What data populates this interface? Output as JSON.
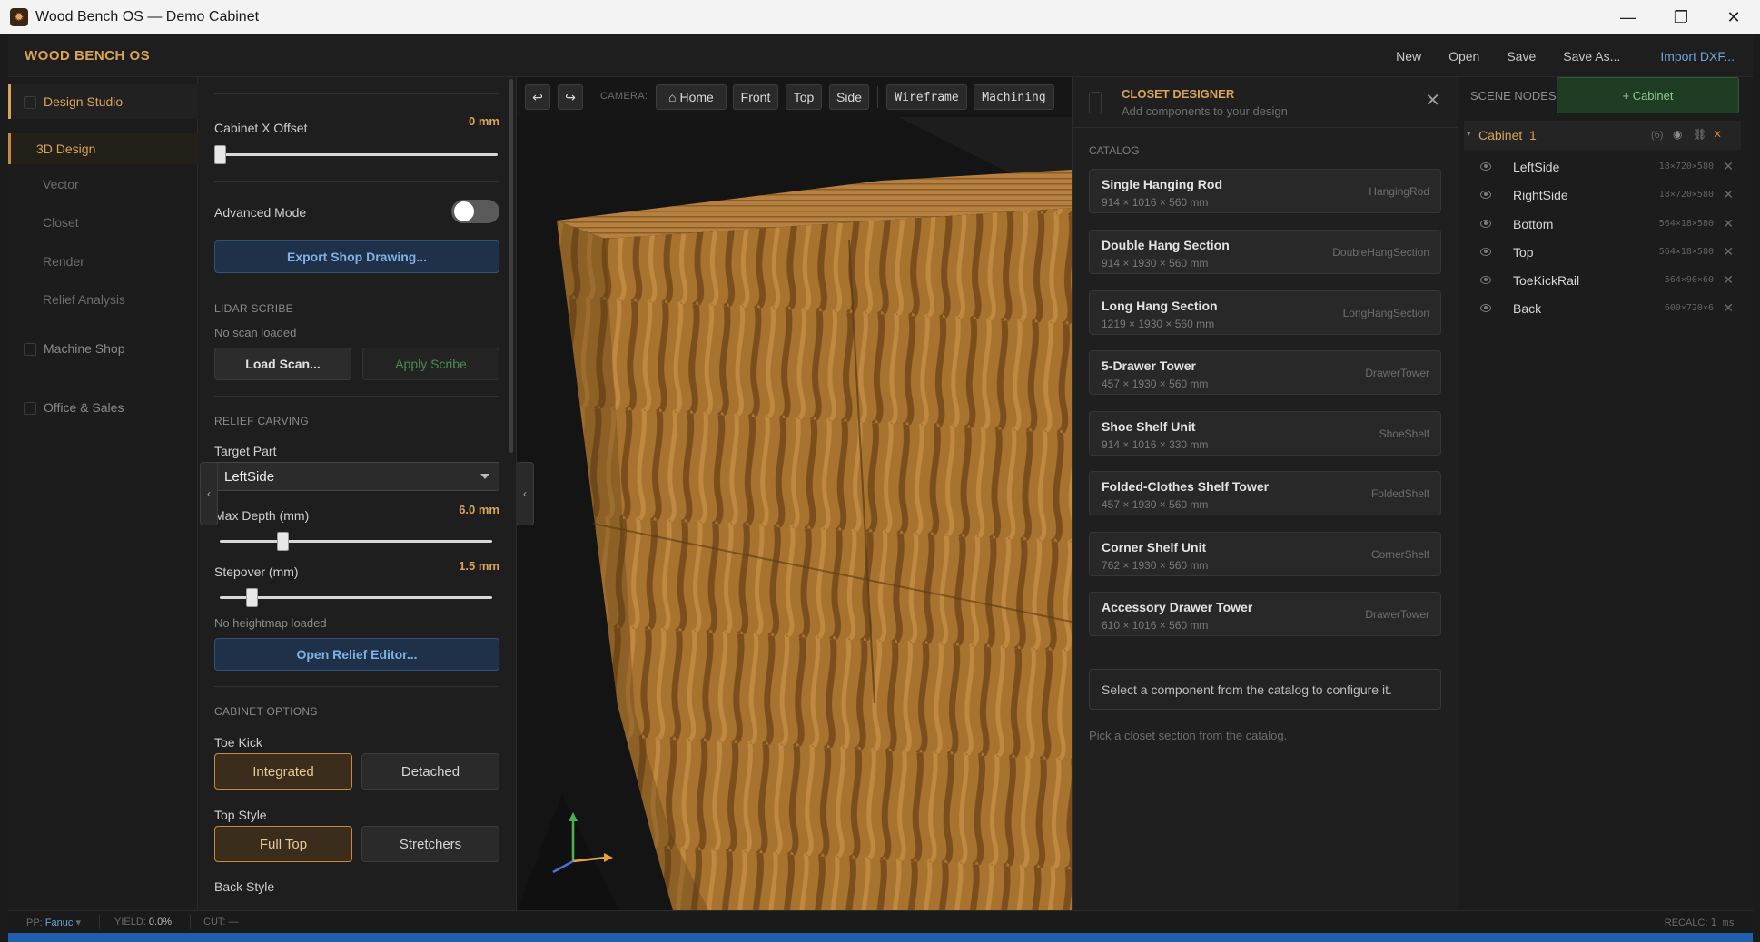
{
  "window": {
    "title": "Wood Bench OS — Demo Cabinet",
    "controls": {
      "minimize": "—",
      "restore": "❐",
      "close": "✕"
    }
  },
  "header": {
    "brand": "WOOD BENCH OS",
    "menu": {
      "new": "New",
      "open": "Open",
      "save": "Save",
      "save_as": "Save As...",
      "import": "Import DXF..."
    }
  },
  "nav": {
    "design_studio": "Design Studio",
    "design_3d": "3D Design",
    "vector": "Vector",
    "closet": "Closet",
    "render": "Render",
    "relief": "Relief Analysis",
    "machine_shop": "Machine Shop",
    "office_sales": "Office & Sales"
  },
  "props": {
    "cabinet_x_offset": {
      "label": "Cabinet X Offset",
      "value": "0 mm",
      "level": 0.0
    },
    "advanced_mode": {
      "label": "Advanced Mode",
      "on": false
    },
    "export_btn": "Export Shop Drawing...",
    "lidar": {
      "title": "LIDAR SCRIBE",
      "status": "No scan loaded",
      "load": "Load Scan...",
      "apply": "Apply Scribe"
    },
    "relief": {
      "title": "RELIEF CARVING",
      "target_label": "Target Part",
      "target_value": "LeftSide",
      "max_depth": {
        "label": "Max Depth (mm)",
        "value": "6.0 mm",
        "level": 0.22
      },
      "stepover": {
        "label": "Stepover (mm)",
        "value": "1.5 mm",
        "level": 0.1
      },
      "heightmap": "No heightmap loaded",
      "open_editor": "Open Relief Editor..."
    },
    "cabinet_options": {
      "title": "CABINET OPTIONS",
      "toe_kick": {
        "label": "Toe Kick",
        "options": [
          "Integrated",
          "Detached"
        ],
        "selected": "Integrated"
      },
      "top_style": {
        "label": "Top Style",
        "options": [
          "Full Top",
          "Stretchers"
        ],
        "selected": "Full Top"
      },
      "back_style": {
        "label": "Back Style"
      }
    }
  },
  "viewport": {
    "undo_icon": "↩",
    "redo_icon": "↪",
    "camera_label": "CAMERA:",
    "home": "⌂ Home",
    "front": "Front",
    "top": "Top",
    "side": "Side",
    "wireframe": "Wireframe",
    "machining": "Machining",
    "wood_colors": {
      "light": "#b07a34",
      "dark": "#6e4a1c"
    }
  },
  "closet": {
    "title": "CLOSET DESIGNER",
    "subtitle": "Add components to your design",
    "close_icon": "✕",
    "catalog_label": "CATALOG",
    "items": [
      {
        "name": "Single Hanging Rod",
        "dims": "914 × 1016 × 560 mm",
        "code": "HangingRod"
      },
      {
        "name": "Double Hang Section",
        "dims": "914 × 1930 × 560 mm",
        "code": "DoubleHangSection"
      },
      {
        "name": "Long Hang Section",
        "dims": "1219 × 1930 × 560 mm",
        "code": "LongHangSection"
      },
      {
        "name": "5-Drawer Tower",
        "dims": "457 × 1930 × 560 mm",
        "code": "DrawerTower"
      },
      {
        "name": "Shoe Shelf Unit",
        "dims": "914 × 1016 × 330 mm",
        "code": "ShoeShelf"
      },
      {
        "name": "Folded-Clothes Shelf Tower",
        "dims": "457 × 1930 × 560 mm",
        "code": "FoldedShelf"
      },
      {
        "name": "Corner Shelf Unit",
        "dims": "762 × 1930 × 560 mm",
        "code": "CornerShelf"
      },
      {
        "name": "Accessory Drawer Tower",
        "dims": "610 × 1016 × 560 mm",
        "code": "DrawerTower"
      }
    ],
    "info": "Select a component from the catalog to configure it.",
    "hint": "Pick a closet section from the catalog."
  },
  "scene": {
    "title": "SCENE NODES",
    "add_cabinet": "+ Cabinet",
    "cabinet": {
      "name": "Cabinet_1",
      "count": "(6)"
    },
    "nodes": [
      {
        "name": "LeftSide",
        "dims": "18×720×580"
      },
      {
        "name": "RightSide",
        "dims": "18×720×580"
      },
      {
        "name": "Bottom",
        "dims": "564×18×580"
      },
      {
        "name": "Top",
        "dims": "564×18×580"
      },
      {
        "name": "ToeKickRail",
        "dims": "564×90×60"
      },
      {
        "name": "Back",
        "dims": "600×720×6"
      }
    ]
  },
  "status": {
    "pp_label": "PP:",
    "pp_value": "Fanuc",
    "yield_label": "YIELD:",
    "yield_value": "0.0%",
    "cut_label": "CUT:",
    "cut_value": "—",
    "recalc_label": "RECALC:",
    "recalc_value": "1 ms"
  }
}
